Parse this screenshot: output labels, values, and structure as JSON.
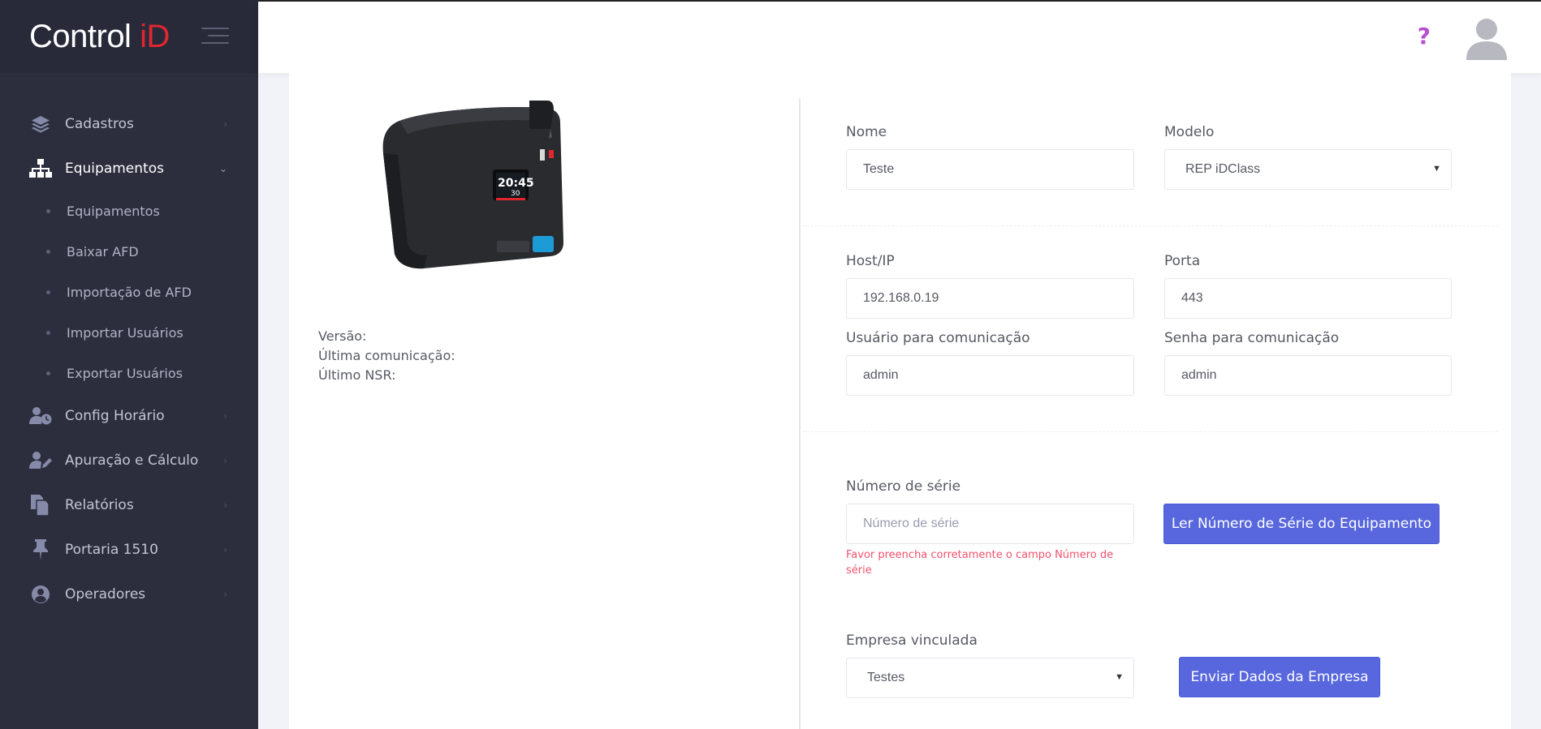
{
  "brand": {
    "name_prefix": "Control ",
    "name_accent": "iD"
  },
  "sidebar": {
    "items": [
      {
        "label": "Cadastros",
        "icon": "layers-icon"
      },
      {
        "label": "Equipamentos",
        "icon": "sitemap-icon"
      },
      {
        "label": "Config Horário",
        "icon": "user-clock-icon"
      },
      {
        "label": "Apuração e Cálculo",
        "icon": "user-edit-icon"
      },
      {
        "label": "Relatórios",
        "icon": "copy-icon"
      },
      {
        "label": "Portaria 1510",
        "icon": "pin-icon"
      },
      {
        "label": "Operadores",
        "icon": "user-circle-icon"
      }
    ],
    "submenu": [
      {
        "label": "Equipamentos"
      },
      {
        "label": "Baixar AFD"
      },
      {
        "label": "Importação de AFD"
      },
      {
        "label": "Importar Usuários"
      },
      {
        "label": "Exportar Usuários"
      }
    ]
  },
  "header": {
    "help_symbol": "?"
  },
  "device_panel": {
    "screen_time": "20:45",
    "screen_num": "30",
    "versao_label": "Versão:",
    "ultima_comunicacao_label": "Última comunicação:",
    "ultimo_nsr_label": "Último NSR:"
  },
  "form": {
    "nome": {
      "label": "Nome",
      "value": "Teste"
    },
    "modelo": {
      "label": "Modelo",
      "value": "REP iDClass"
    },
    "host": {
      "label": "Host/IP",
      "value": "192.168.0.19"
    },
    "porta": {
      "label": "Porta",
      "value": "443"
    },
    "usuario": {
      "label": "Usuário para comunicação",
      "value": "admin"
    },
    "senha": {
      "label": "Senha para comunicação",
      "value": "admin"
    },
    "serie": {
      "label": "Número de série",
      "placeholder": "Número de série",
      "error_line1": "Favor preencha corretamente o campo Número de",
      "error_line2": "série"
    },
    "ler_serie_button": "Ler Número de Série do Equipamento",
    "empresa": {
      "label": "Empresa vinculada",
      "value": "Testes"
    },
    "enviar_button": "Enviar Dados da Empresa"
  },
  "colors": {
    "primary": "#5867dd",
    "sidebar": "#2c2e3e",
    "error": "#f4516c",
    "help": "#b74ed1",
    "brand_accent": "#e0262f"
  }
}
